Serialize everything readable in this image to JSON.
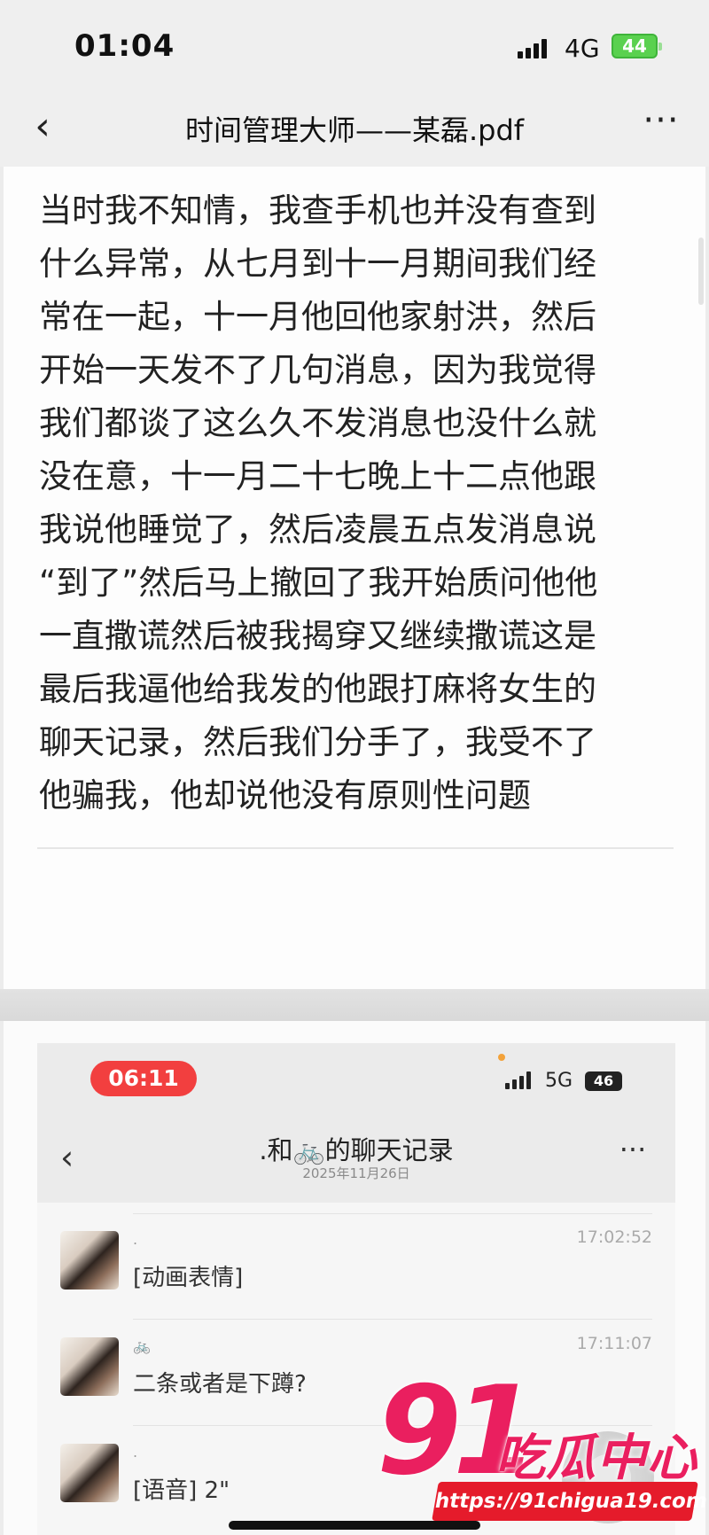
{
  "status_bar": {
    "time": "01:04",
    "network": "4G",
    "battery": "44"
  },
  "nav": {
    "back_icon": "chevron-left-icon",
    "title": "时间管理大师——某磊.pdf",
    "more_icon": "more-dots-icon"
  },
  "document": {
    "paragraph": "当时我不知情，我查手机也并没有查到\n什么异常，从七月到十一月期间我们经\n常在一起，十一月他回他家射洪，然后\n开始一天发不了几句消息，因为我觉得\n我们都谈了这么久不发消息也没什么就\n没在意，十一月二十七晚上十二点他跟\n我说他睡觉了，然后凌晨五点发消息说\n“到了”然后马上撤回了我开始质问他他\n一直撒谎然后被我揭穿又继续撒谎这是\n最后我逼他给我发的他跟打麻将女生的\n聊天记录，然后我们分手了，我受不了\n他骗我，他却说他没有原则性问题"
  },
  "chat_screenshot": {
    "status": {
      "time": "06:11",
      "network": "5G",
      "battery": "46"
    },
    "title": ".和🚲的聊天记录",
    "subtitle": "2025年11月26日",
    "messages": [
      {
        "name": ".",
        "text": "[动画表情]",
        "time": "17:02:52"
      },
      {
        "name": "🚲",
        "text": "二条或者是下蹲?",
        "time": "17:11:07"
      },
      {
        "name": ".",
        "text": "[语音] 2\"",
        "time": ""
      }
    ]
  },
  "watermark": {
    "logo_number": "91",
    "logo_text": "吃瓜中心",
    "url": "https://91chigua19.com"
  }
}
